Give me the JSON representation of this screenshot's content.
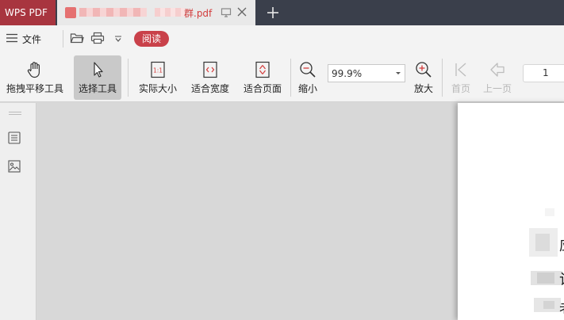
{
  "titlebar": {
    "app_name": "WPS PDF",
    "doc_tab_title": "群.pdf",
    "icons": [
      "screen-icon",
      "close-icon",
      "plus-icon"
    ]
  },
  "menubar": {
    "file_label": "文件",
    "read_label": "阅读",
    "read_color": "#c9414a"
  },
  "toolbar": {
    "pan_label": "拖拽平移工具",
    "select_label": "选择工具",
    "actual_size_label": "实际大小",
    "fit_width_label": "适合宽度",
    "fit_page_label": "适合页面",
    "zoom_out_label": "缩小",
    "zoom_value": "99.9%",
    "zoom_in_label": "放大",
    "first_page_label": "首页",
    "prev_page_label": "上一页",
    "page_number": "1",
    "actual_size_glyph": "1:1"
  },
  "page": {
    "text_frags": [
      "应",
      "计",
      "老"
    ]
  }
}
